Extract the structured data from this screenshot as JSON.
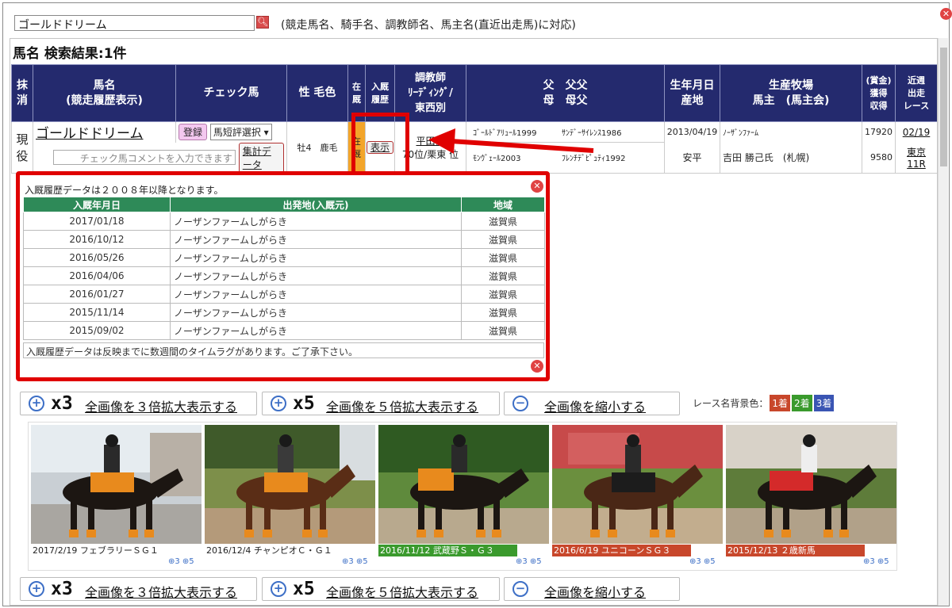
{
  "search": {
    "value": "ゴールドドリーム",
    "hint": "(競走馬名、騎手名、調教師名、馬主名(直近出走馬)に対応)"
  },
  "result_title": "馬名 検索結果:1件",
  "headers": {
    "cancel_a": "抹",
    "cancel_b": "消",
    "name_a": "馬名",
    "name_b": "(競走履歴表示)",
    "check": "チェック馬",
    "sex_color": "性 毛色",
    "stable_a": "在",
    "stable_b": "厩",
    "entry_a": "入厩",
    "entry_b": "履歴",
    "trainer_a": "調教師",
    "trainer_b": "ﾘｰﾃﾞｨﾝｸﾞ/",
    "trainer_c": "東西別",
    "sire_a": "父　父父",
    "sire_b": "母　母父",
    "birth_a": "生年月日",
    "birth_b": "産地",
    "farm_a": "生産牧場",
    "farm_b": "馬主　(馬主会)",
    "prize_a": "(賞金)",
    "prize_b": "獲得",
    "prize_c": "収得",
    "recent_a": "近週",
    "recent_b": "出走",
    "recent_c": "レース"
  },
  "horse": {
    "status_a": "現",
    "status_b": "役",
    "name": "ゴールドドリーム",
    "register_label": "登録",
    "eval_select": "馬短評選択 ▾",
    "comment_placeholder": "チェック馬コメントを入力できます",
    "sum_label": "集計データ",
    "sex_color": "牡4　鹿毛",
    "stable_a": "在",
    "stable_b": "厩",
    "show_label": "表示",
    "trainer_a": "平田修",
    "trainer_b": "70位/栗東",
    "trainer_c": "位",
    "sire": "ｺﾞｰﾙﾄﾞｱﾘｭｰﾙ1999",
    "sire_sire": "ｻﾝﾃﾞｰｻｲﾚﾝｽ1986",
    "dam": "ﾓﾝｳﾞｪｰﾙ2003",
    "dam_sire": "ﾌﾚﾝﾁﾃﾞﾋﾟｭﾃｨ1992",
    "birth": "2013/04/19",
    "birthplace": "安平",
    "farm": "ﾉｰｻﾞﾝﾌｧｰﾑ",
    "owner": "吉田 勝己氏　(札幌)",
    "prize_earned": "17920",
    "prize_collected": "9580",
    "recent_date": "02/19",
    "recent_race": "東京11R"
  },
  "popup": {
    "note": "入厩履歴データは２００８年以降となります。",
    "columns": [
      "入厩年月日",
      "出発地(入厩元)",
      "地域"
    ],
    "rows": [
      [
        "2017/01/18",
        "ノーザンファームしがらき",
        "滋賀県"
      ],
      [
        "2016/10/12",
        "ノーザンファームしがらき",
        "滋賀県"
      ],
      [
        "2016/05/26",
        "ノーザンファームしがらき",
        "滋賀県"
      ],
      [
        "2016/04/06",
        "ノーザンファームしがらき",
        "滋賀県"
      ],
      [
        "2016/01/27",
        "ノーザンファームしがらき",
        "滋賀県"
      ],
      [
        "2015/11/14",
        "ノーザンファームしがらき",
        "滋賀県"
      ],
      [
        "2015/09/02",
        "ノーザンファームしがらき",
        "滋賀県"
      ]
    ],
    "footer": "入厩履歴データは反映までに数週間のタイムラグがあります。ご了承下さい。"
  },
  "zoom": {
    "x3_mark": "x3",
    "x3_label": "全画像を３倍拡大表示する",
    "x5_mark": "x5",
    "x5_label": "全画像を５倍拡大表示する",
    "shrink_label": "全画像を縮小する"
  },
  "legend": {
    "label": "レース名背景色：",
    "first": "1着",
    "second": "2着",
    "third": "3着"
  },
  "photos": [
    {
      "caption": "2017/2/19 フェブラリーＳＧ１",
      "color": ""
    },
    {
      "caption": "2016/12/4 チャンピオＣ・Ｇ１",
      "color": ""
    },
    {
      "caption": "2016/11/12 武蔵野Ｓ・Ｇ３",
      "color": "#3a9a2d"
    },
    {
      "caption": "2016/6/19 ユニコーンＳＧ３",
      "color": "#c8472b"
    },
    {
      "caption": "2015/12/13 ２歳新馬",
      "color": "#c8472b"
    }
  ],
  "photo_zoom": "⊕3 ⊕5"
}
